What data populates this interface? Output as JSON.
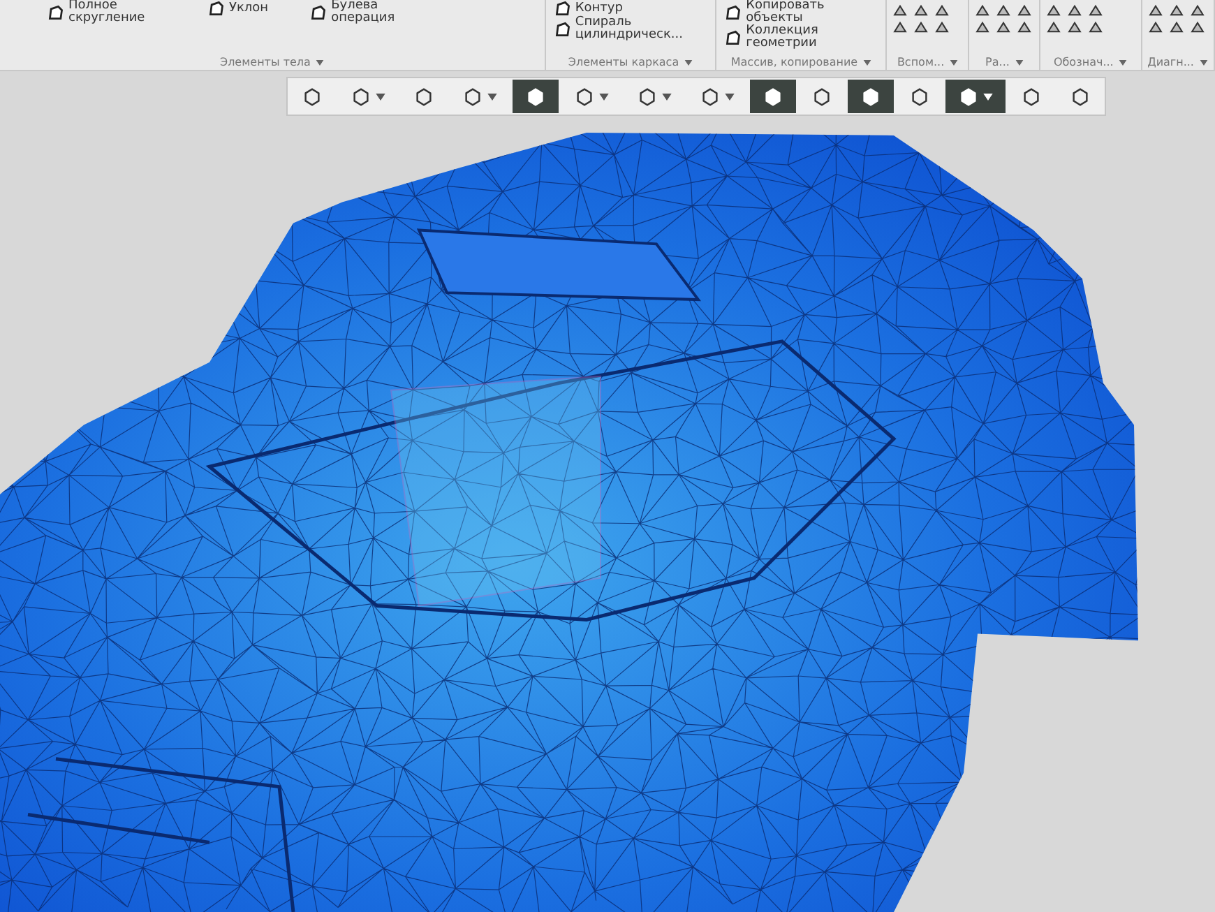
{
  "ribbon": {
    "groups": [
      {
        "label": "Элементы тела",
        "kind": "commands",
        "items": [
          {
            "label": "Полное скругление"
          },
          {
            "label": "Уклон"
          },
          {
            "label": "Булева операция"
          }
        ]
      },
      {
        "label": "Элементы каркаса",
        "kind": "commands",
        "items": [
          {
            "label": "Контур"
          },
          {
            "label": "Спираль цилиндрическ..."
          }
        ]
      },
      {
        "label": "Массив, копирование",
        "kind": "commands",
        "items": [
          {
            "label": "Копировать объекты"
          },
          {
            "label": "Коллекция геометрии"
          }
        ]
      },
      {
        "label": "Вспом...",
        "kind": "icons"
      },
      {
        "label": "Ра...",
        "kind": "icons"
      },
      {
        "label": "Обознач...",
        "kind": "icons"
      },
      {
        "label": "Диагн...",
        "kind": "icons"
      }
    ]
  },
  "toolbar": {
    "buttons": [
      {
        "kind": "plain",
        "selected": false
      },
      {
        "kind": "split",
        "selected": false
      },
      {
        "kind": "plain",
        "selected": false
      },
      {
        "kind": "split",
        "selected": false
      },
      {
        "kind": "plain",
        "selected": true
      },
      {
        "kind": "split",
        "selected": false
      },
      {
        "kind": "split",
        "selected": false
      },
      {
        "kind": "split",
        "selected": false
      },
      {
        "kind": "plain",
        "selected": true
      },
      {
        "kind": "plain",
        "selected": false
      },
      {
        "kind": "plain",
        "selected": true
      },
      {
        "kind": "plain",
        "selected": false
      },
      {
        "kind": "split",
        "selected": true
      },
      {
        "kind": "plain",
        "selected": false
      },
      {
        "kind": "plain",
        "selected": false
      }
    ]
  }
}
